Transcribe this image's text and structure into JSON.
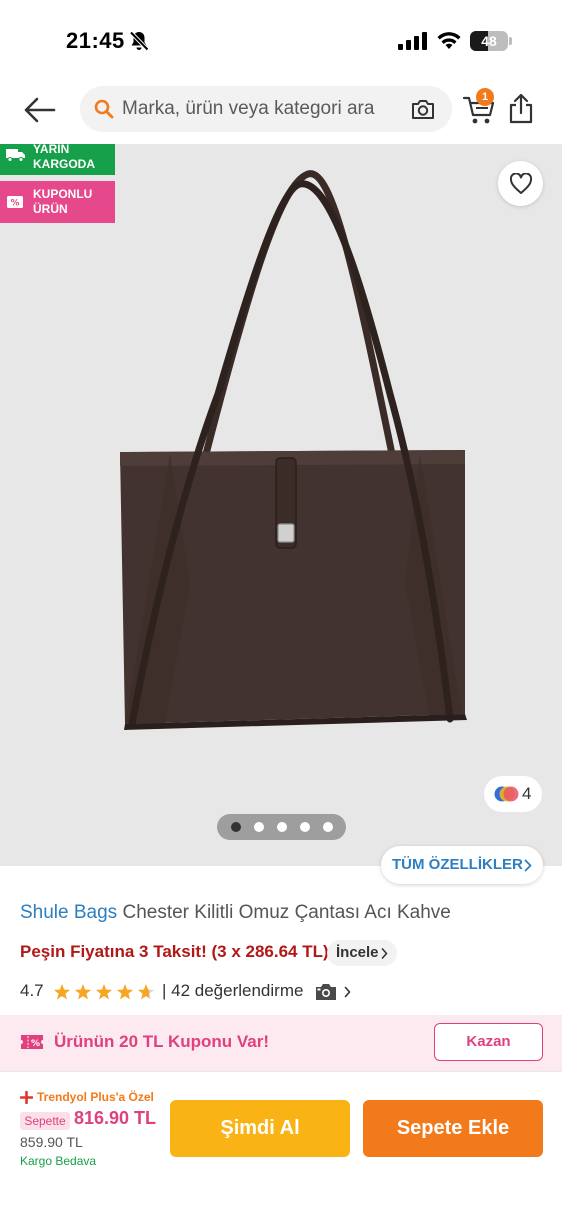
{
  "status_bar": {
    "time": "21:45",
    "battery": "48",
    "battery_level": 0.48,
    "icons": [
      "bell-slash-icon",
      "signal-icon",
      "wifi-icon",
      "battery-icon"
    ]
  },
  "header": {
    "search_placeholder": "Marka, ürün veya kategori ara",
    "cart_count": "1",
    "icons": [
      "back-arrow-icon",
      "search-icon",
      "camera-icon",
      "cart-icon",
      "share-icon"
    ]
  },
  "gallery": {
    "badges": [
      {
        "label": "YARIN\nKARGODA",
        "color": "#17a04a",
        "icon": "truck-icon"
      },
      {
        "label": "KUPONLU\nÜRÜN",
        "color": "#e5498c",
        "icon": "coupon-icon"
      }
    ],
    "color_count": "4",
    "image_count": 5,
    "active_image": 1,
    "features_label": "TÜM ÖZELLİKLER"
  },
  "product": {
    "brand": "Shule Bags",
    "name": "Chester Kilitli Omuz Çantası Acı Kahve",
    "installment": "Peşin Fiyatına 3 Taksit! (3 x 286.64 TL)",
    "installment_link": "İncele",
    "rating": "4.7",
    "rating_value": 4.7,
    "review_count": "| 42 değerlendirme"
  },
  "coupon": {
    "text": "Ürünün 20 TL Kuponu Var!",
    "button": "Kazan"
  },
  "footer": {
    "plus_label": "Trendyol Plus'a Özel",
    "sepette_tag": "Sepette",
    "sepette_price": "816.90 TL",
    "old_price": "859.90 TL",
    "shipping": "Kargo Bedava",
    "buy_now": "Şimdi Al",
    "add_to_cart": "Sepete Ekle"
  },
  "colors": {
    "orange": "#f27a1a",
    "pink": "#e0407f",
    "green": "#17a04a",
    "blue": "#2b7fc0",
    "red": "#b01916",
    "yellow": "#f9b314"
  }
}
